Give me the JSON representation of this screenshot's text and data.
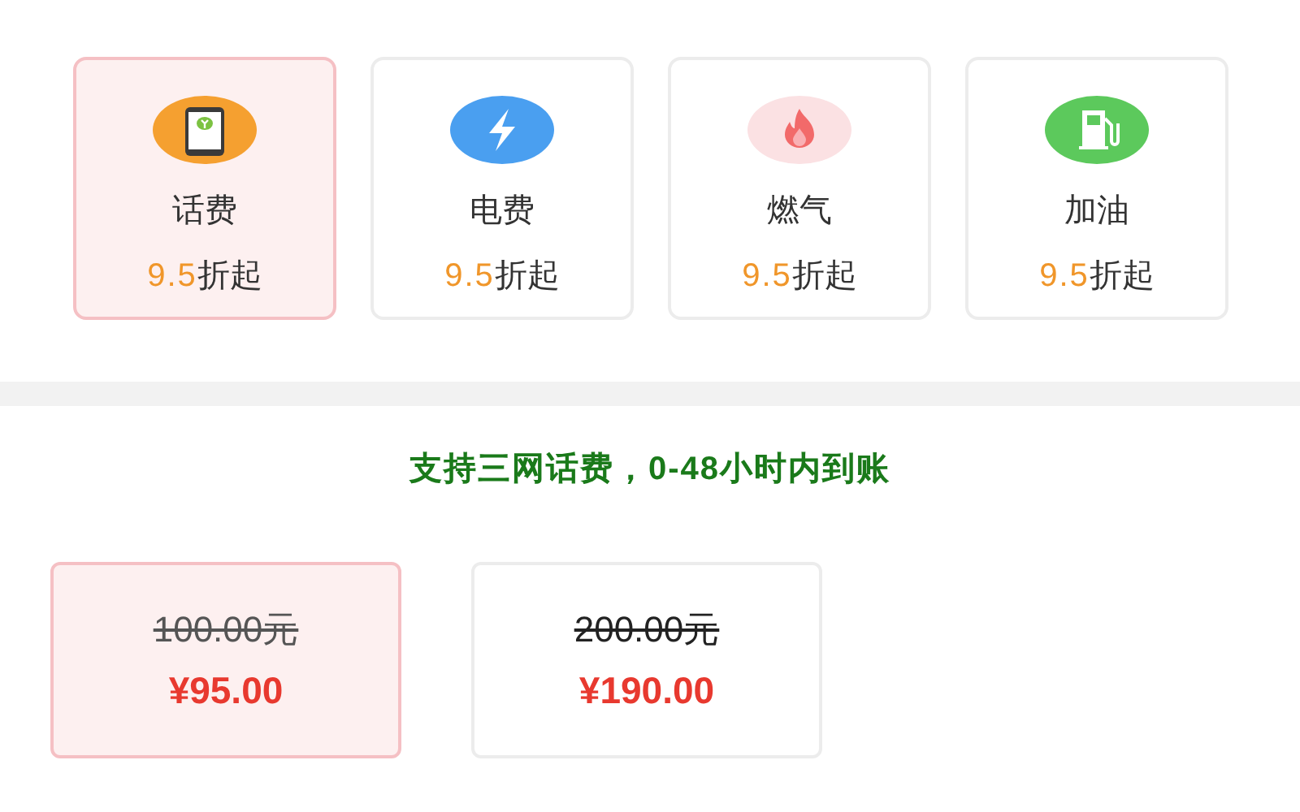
{
  "categories": [
    {
      "kind": "phone",
      "label": "话费",
      "discount": "9.5",
      "suffix": "折起",
      "selected": true
    },
    {
      "kind": "bolt",
      "label": "电费",
      "discount": "9.5",
      "suffix": "折起",
      "selected": false
    },
    {
      "kind": "flame",
      "label": "燃气",
      "discount": "9.5",
      "suffix": "折起",
      "selected": false
    },
    {
      "kind": "fuel",
      "label": "加油",
      "discount": "9.5",
      "suffix": "折起",
      "selected": false
    }
  ],
  "notice": "支持三网话费，0-48小时内到账",
  "amounts": [
    {
      "original": "100.00元",
      "price": "¥95.00",
      "selected": true
    },
    {
      "original": "200.00元",
      "price": "¥190.00",
      "selected": false
    }
  ]
}
